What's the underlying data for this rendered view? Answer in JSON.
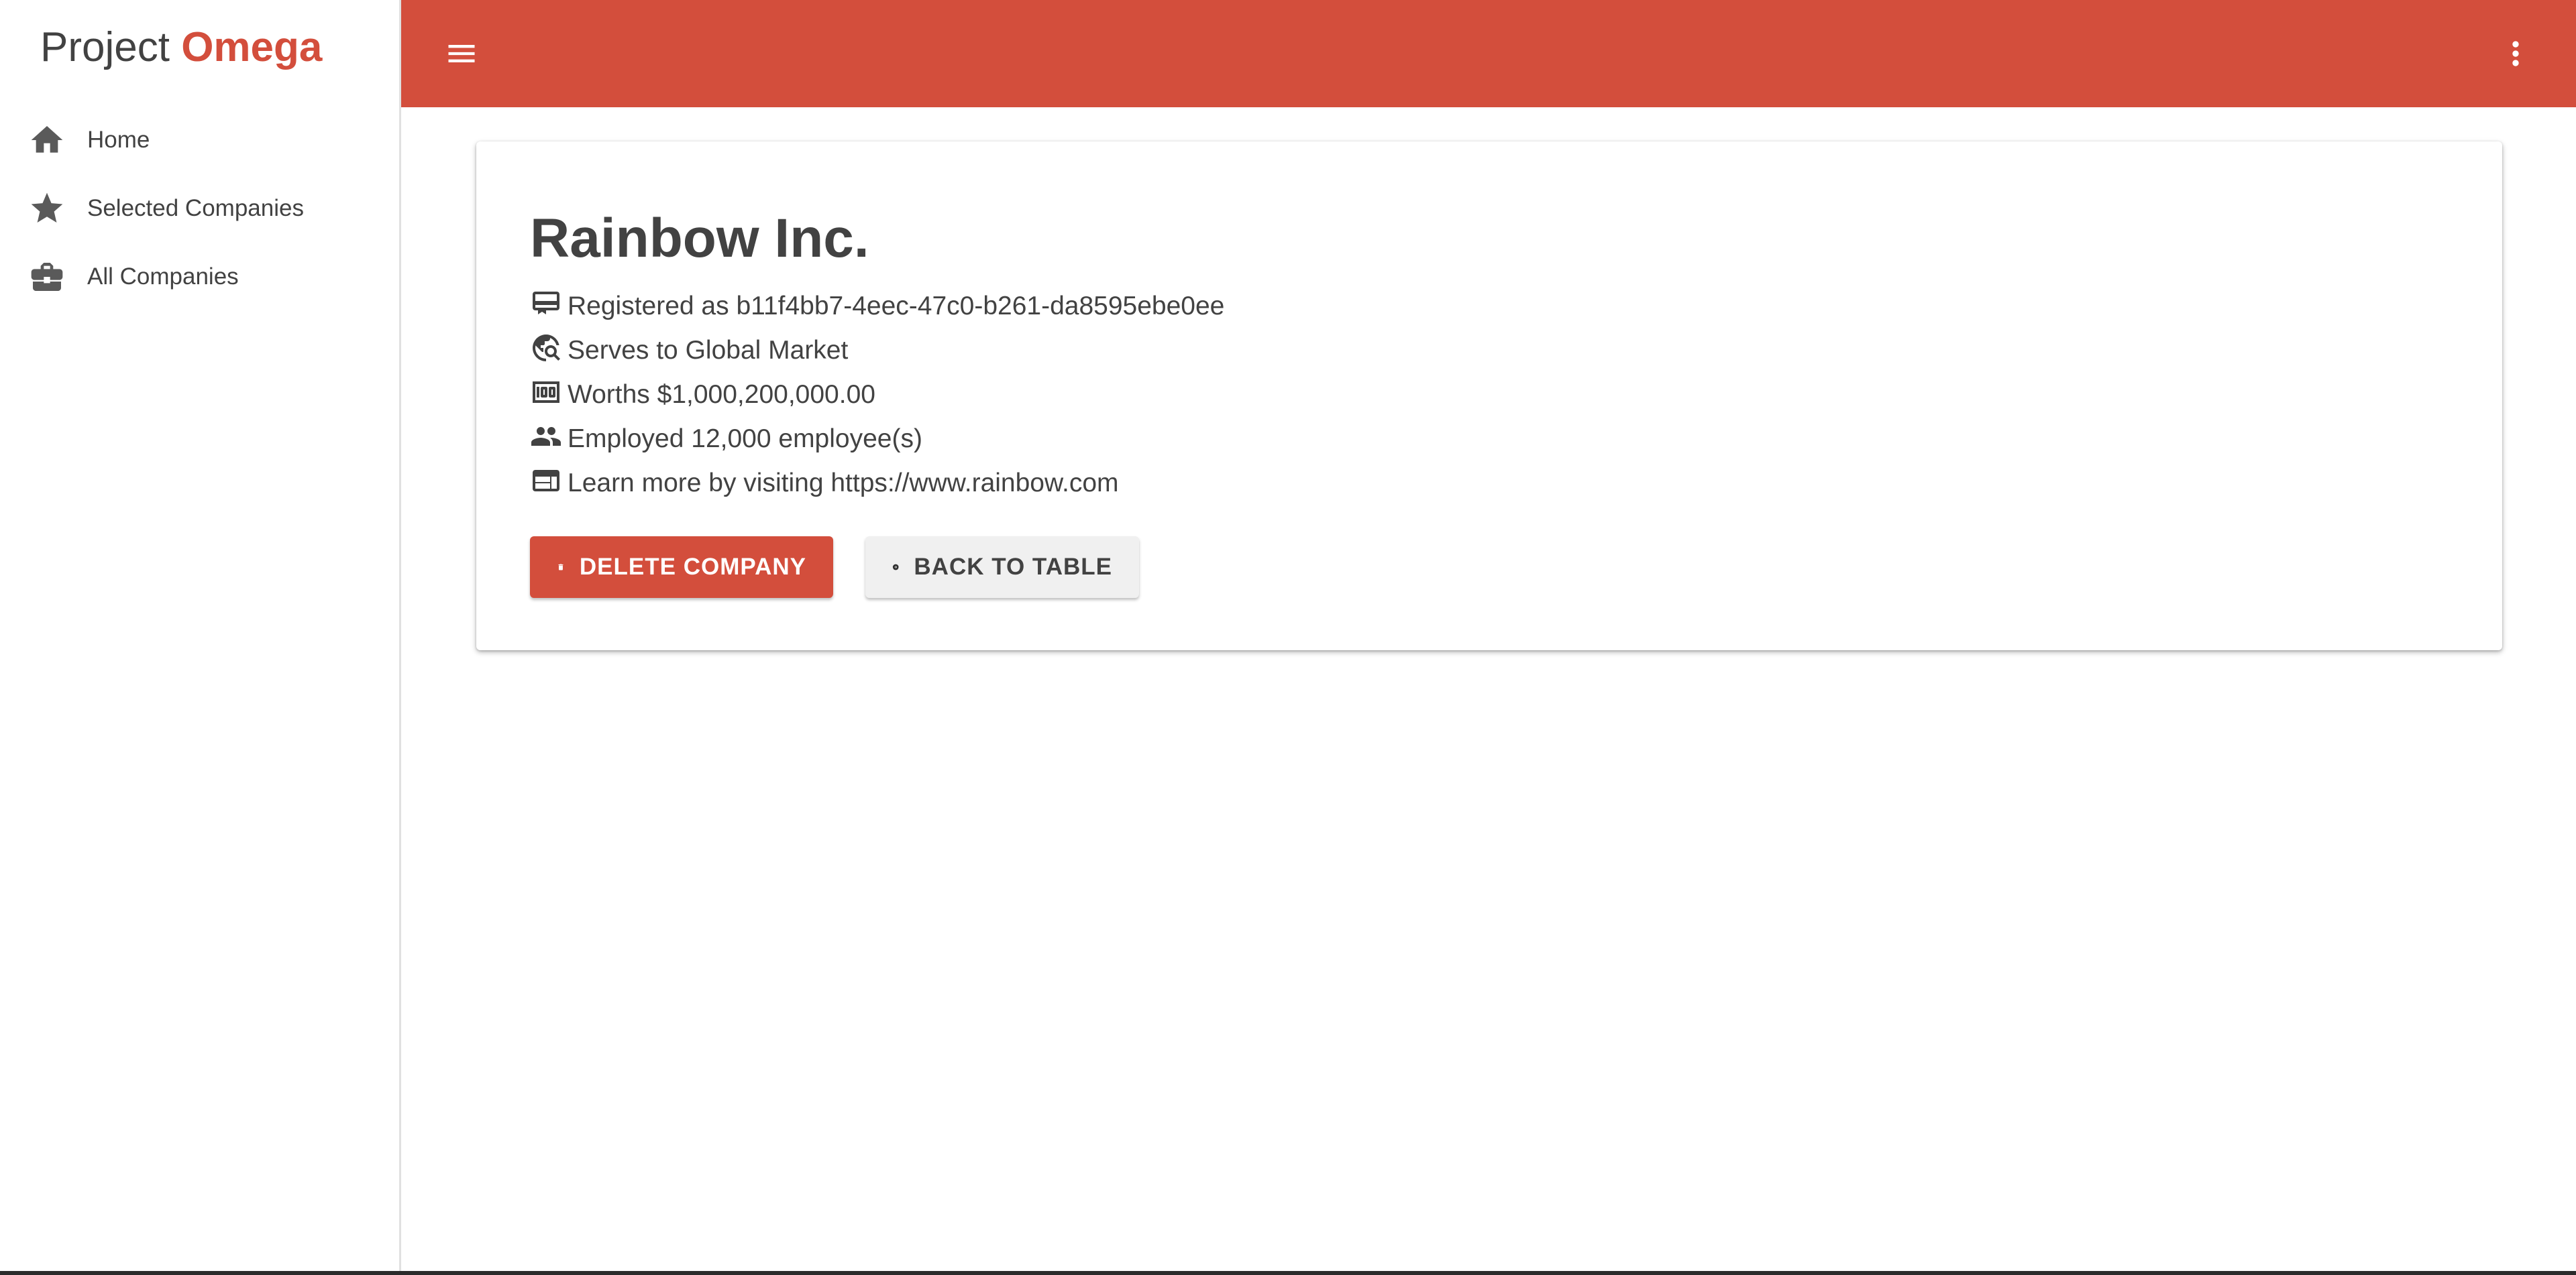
{
  "brand": {
    "prefix": "Project",
    "accent": "Omega",
    "accent_color": "#d34e3c"
  },
  "sidebar": {
    "items": [
      {
        "label": "Home",
        "icon": "home-icon"
      },
      {
        "label": "Selected Companies",
        "icon": "star-icon"
      },
      {
        "label": "All Companies",
        "icon": "briefcase-icon"
      }
    ]
  },
  "topbar": {
    "color": "#d34e3c",
    "menu_icon": "hamburger-menu-icon",
    "more_icon": "more-vert-icon"
  },
  "company": {
    "name": "Rainbow Inc.",
    "details": [
      {
        "icon": "registration-icon",
        "text": "Registered as b11f4bb7-4eec-47c0-b261-da8595ebe0ee"
      },
      {
        "icon": "travel-explore-icon",
        "text": "Serves to Global Market"
      },
      {
        "icon": "money-icon",
        "text": "Worths $1,000,200,000.00"
      },
      {
        "icon": "people-icon",
        "text": "Employed 12,000 employee(s)"
      },
      {
        "icon": "web-icon",
        "text": "Learn more by visiting https://www.rainbow.com"
      }
    ]
  },
  "actions": {
    "delete_label": "DELETE COMPANY",
    "delete_icon": "trash-icon",
    "back_label": "BACK TO TABLE",
    "back_icon": "arrow-circle-right-icon"
  }
}
